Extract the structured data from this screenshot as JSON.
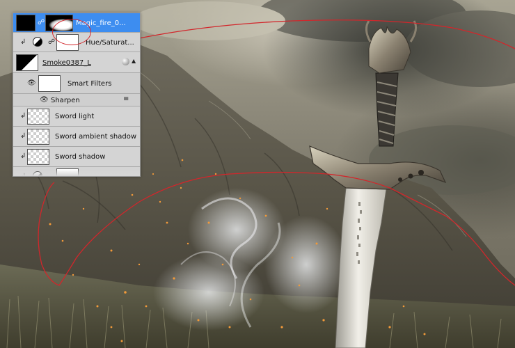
{
  "layers": [
    {
      "id": "magic-fire",
      "label": "Magic_fire_0...",
      "selected": true,
      "icon": "layer-mask-icon"
    },
    {
      "id": "hue-saturation",
      "label": "Hue/Saturat...",
      "selected": false,
      "icon": "adjustment-layer-icon"
    },
    {
      "id": "smoke",
      "label": "Smoke0387_L",
      "selected": false,
      "icon": "smart-object-icon"
    },
    {
      "id": "smart-filters",
      "label": "Smart Filters",
      "selected": false,
      "icon": "filter-mask-icon"
    },
    {
      "id": "sharpen",
      "label": "Sharpen",
      "selected": false,
      "icon": "filter-options-icon"
    },
    {
      "id": "sword-light",
      "label": "Sword light",
      "selected": false,
      "icon": "clipping-arrow-icon"
    },
    {
      "id": "sword-ambient-shadow",
      "label": "Sword ambient shadow",
      "selected": false,
      "icon": "clipping-arrow-icon"
    },
    {
      "id": "sword-shadow",
      "label": "Sword shadow",
      "selected": false,
      "icon": "clipping-arrow-icon"
    }
  ],
  "colors": {
    "selection": "#3d8df0",
    "annotation": "#d2262b",
    "panel": "#d6d6d6"
  }
}
